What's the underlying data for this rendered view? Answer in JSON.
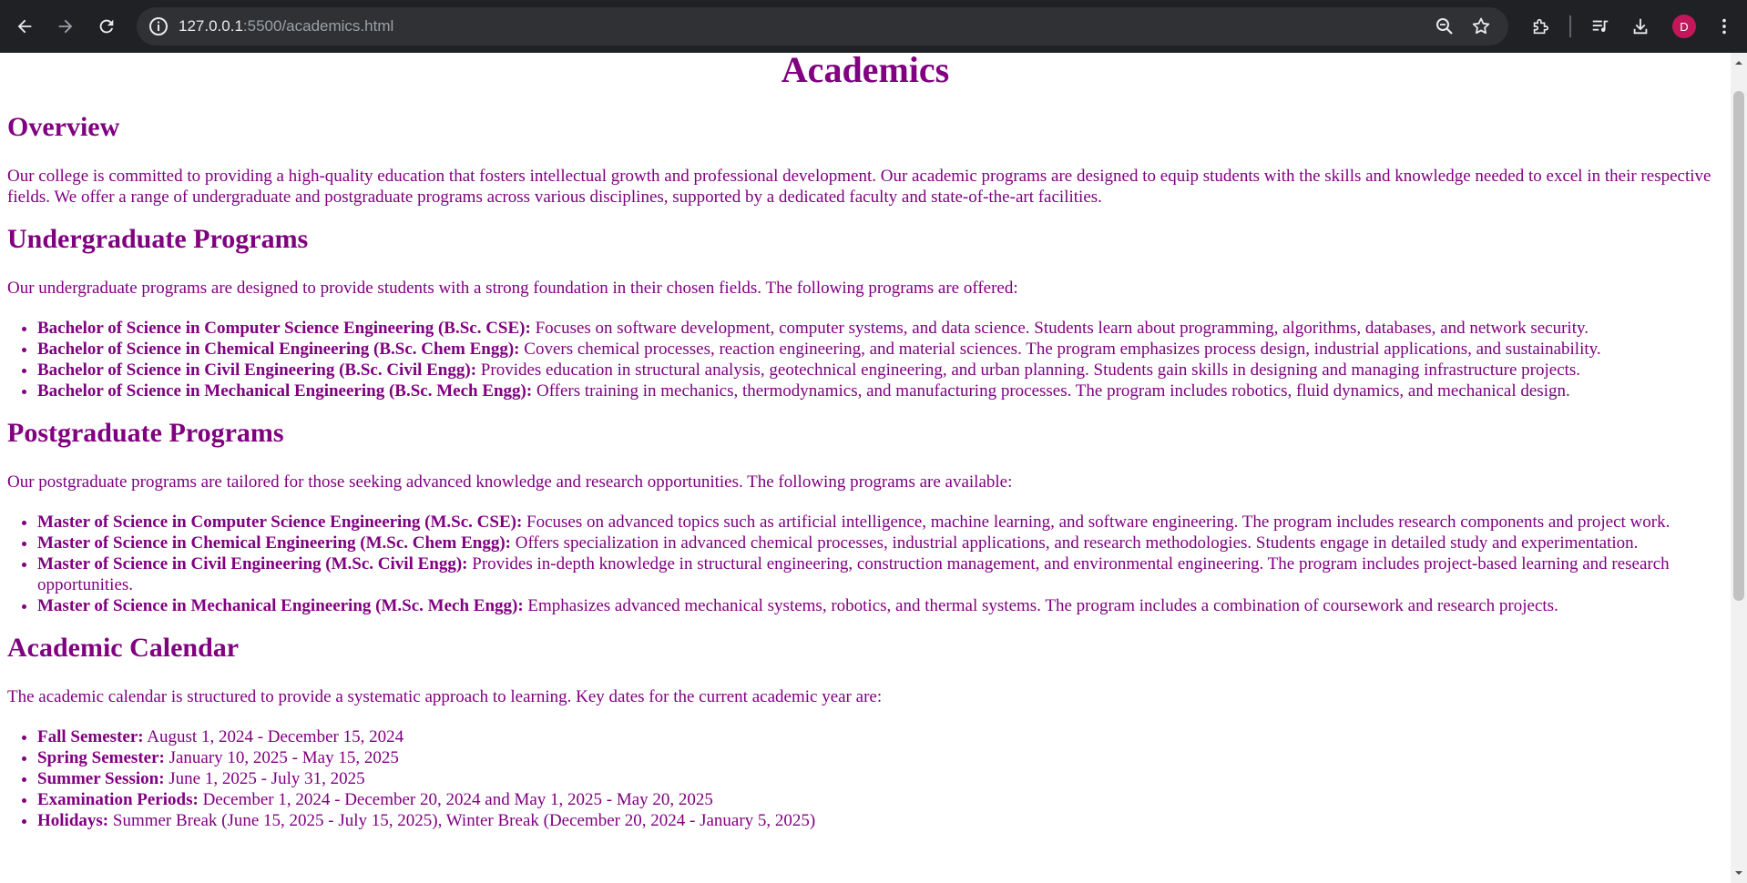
{
  "browser": {
    "url_host": "127.0.0.1",
    "url_rest": ":5500/academics.html",
    "avatar_letter": "D",
    "icons": [
      "back-icon",
      "forward-icon",
      "reload-icon",
      "site-info-icon",
      "zoom-icon",
      "bookmark-star-icon",
      "extensions-icon",
      "media-controls-icon",
      "download-icon",
      "more-menu-icon"
    ]
  },
  "page": {
    "title": "Academics",
    "sections": [
      {
        "heading": "Overview",
        "paragraph": "Our college is committed to providing a high-quality education that fosters intellectual growth and professional development. Our academic programs are designed to equip students with the skills and knowledge needed to excel in their respective fields. We offer a range of undergraduate and postgraduate programs across various disciplines, supported by a dedicated faculty and state-of-the-art facilities.",
        "items": []
      },
      {
        "heading": "Undergraduate Programs",
        "paragraph": "Our undergraduate programs are designed to provide students with a strong foundation in their chosen fields. The following programs are offered:",
        "items": [
          {
            "term": "Bachelor of Science in Computer Science Engineering (B.Sc. CSE):",
            "desc": " Focuses on software development, computer systems, and data science. Students learn about programming, algorithms, databases, and network security."
          },
          {
            "term": "Bachelor of Science in Chemical Engineering (B.Sc. Chem Engg):",
            "desc": " Covers chemical processes, reaction engineering, and material sciences. The program emphasizes process design, industrial applications, and sustainability."
          },
          {
            "term": "Bachelor of Science in Civil Engineering (B.Sc. Civil Engg):",
            "desc": " Provides education in structural analysis, geotechnical engineering, and urban planning. Students gain skills in designing and managing infrastructure projects."
          },
          {
            "term": "Bachelor of Science in Mechanical Engineering (B.Sc. Mech Engg):",
            "desc": " Offers training in mechanics, thermodynamics, and manufacturing processes. The program includes robotics, fluid dynamics, and mechanical design."
          }
        ]
      },
      {
        "heading": "Postgraduate Programs",
        "paragraph": "Our postgraduate programs are tailored for those seeking advanced knowledge and research opportunities. The following programs are available:",
        "items": [
          {
            "term": "Master of Science in Computer Science Engineering (M.Sc. CSE):",
            "desc": " Focuses on advanced topics such as artificial intelligence, machine learning, and software engineering. The program includes research components and project work."
          },
          {
            "term": "Master of Science in Chemical Engineering (M.Sc. Chem Engg):",
            "desc": " Offers specialization in advanced chemical processes, industrial applications, and research methodologies. Students engage in detailed study and experimentation."
          },
          {
            "term": "Master of Science in Civil Engineering (M.Sc. Civil Engg):",
            "desc": " Provides in-depth knowledge in structural engineering, construction management, and environmental engineering. The program includes project-based learning and research opportunities."
          },
          {
            "term": "Master of Science in Mechanical Engineering (M.Sc. Mech Engg):",
            "desc": " Emphasizes advanced mechanical systems, robotics, and thermal systems. The program includes a combination of coursework and research projects."
          }
        ]
      },
      {
        "heading": "Academic Calendar",
        "paragraph": "The academic calendar is structured to provide a systematic approach to learning. Key dates for the current academic year are:",
        "items": [
          {
            "term": "Fall Semester:",
            "desc": " August 1, 2024 - December 15, 2024"
          },
          {
            "term": "Spring Semester:",
            "desc": " January 10, 2025 - May 15, 2025"
          },
          {
            "term": "Summer Session:",
            "desc": " June 1, 2025 - July 31, 2025"
          },
          {
            "term": "Examination Periods:",
            "desc": " December 1, 2024 - December 20, 2024 and May 1, 2025 - May 20, 2025"
          },
          {
            "term": "Holidays:",
            "desc": " Summer Break (June 15, 2025 - July 15, 2025), Winter Break (December 20, 2024 - January 5, 2025)"
          }
        ]
      }
    ]
  },
  "colors": {
    "text": "#800080",
    "chrome_bg": "#202124",
    "omnibox_bg": "#303134",
    "avatar_bg": "#c2185b"
  }
}
